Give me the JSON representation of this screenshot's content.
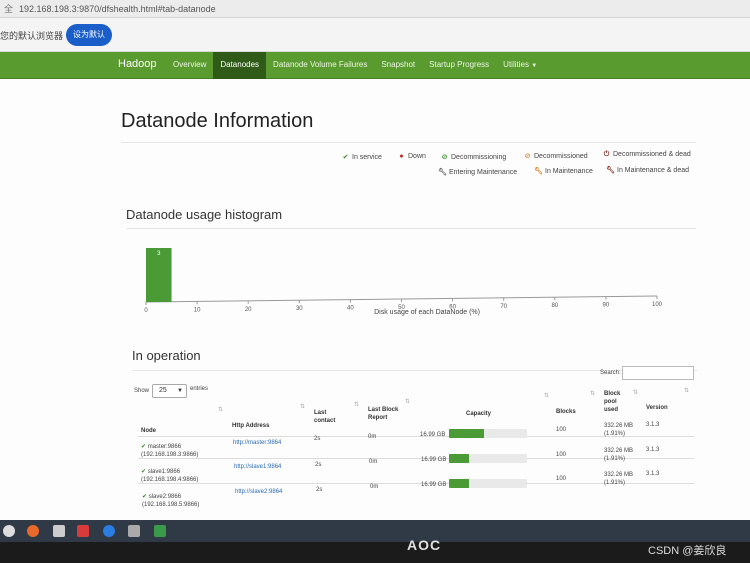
{
  "browser": {
    "url": "192.168.198.3:9870/dfshealth.html#tab-datanode",
    "infobar_message": "您的默认浏览器",
    "set_default_label": "设为默认"
  },
  "nav": {
    "brand": "Hadoop",
    "items": [
      {
        "label": "Overview",
        "active": false
      },
      {
        "label": "Datanodes",
        "active": true
      },
      {
        "label": "Datanode Volume Failures",
        "active": false
      },
      {
        "label": "Snapshot",
        "active": false
      },
      {
        "label": "Startup Progress",
        "active": false
      },
      {
        "label": "Utilities",
        "active": false
      }
    ]
  },
  "title": "Datanode Information",
  "legend": {
    "in_service": "In service",
    "down": "Down",
    "decommissioning": "Decommissioning",
    "decommissioned": "Decommissioned",
    "decommissioned_dead": "Decommissioned & dead",
    "entering_maintenance": "Entering Maintenance",
    "in_maintenance": "In Maintenance",
    "in_maintenance_dead": "In Maintenance & dead"
  },
  "histogram": {
    "heading": "Datanode usage histogram"
  },
  "chart_data": {
    "type": "bar",
    "title": "Datanode usage histogram",
    "xlabel": "Disk usage of each DataNode (%)",
    "ylabel": "",
    "xlim": [
      0,
      100
    ],
    "x_ticks": [
      "0",
      "10",
      "20",
      "30",
      "40",
      "50",
      "60",
      "70",
      "80",
      "90",
      "100"
    ],
    "bins": [
      {
        "x0": 0,
        "x1": 5,
        "value": 3
      }
    ],
    "values": [
      3
    ],
    "grid": false
  },
  "operation": {
    "heading": "In operation",
    "show_label": "Show",
    "entries_value": "25",
    "entries_label": "entries",
    "search_label": "Search:",
    "columns": {
      "node": "Node",
      "http": "Http Address",
      "contact_1": "Last",
      "contact_2": "contact",
      "report_1": "Last Block",
      "report_2": "Report",
      "capacity": "Capacity",
      "blocks": "Blocks",
      "pool_1": "Block",
      "pool_2": "pool",
      "pool_3": "used",
      "version": "Version"
    },
    "rows": [
      {
        "node": "master:9866",
        "ip": "(192.168.198.3:9866)",
        "http": "http://master:9864",
        "contact": "2s",
        "report": "0m",
        "capacity": "16.99 GB",
        "used_pct": 0.45,
        "blocks": "100",
        "pool": "332.26 MB",
        "pool_pct": "(1.91%)",
        "version": "3.1.3"
      },
      {
        "node": "slave1:9866",
        "ip": "(192.168.198.4:9866)",
        "http": "http://slave1:9864",
        "contact": "2s",
        "report": "0m",
        "capacity": "16.99 GB",
        "used_pct": 0.25,
        "blocks": "100",
        "pool": "332.26 MB",
        "pool_pct": "(1.91%)",
        "version": "3.1.3"
      },
      {
        "node": "slave2:9866",
        "ip": "(192.168.198.5:9866)",
        "http": "http://slave2:9864",
        "contact": "2s",
        "report": "0m",
        "capacity": "16.99 GB",
        "used_pct": 0.25,
        "blocks": "100",
        "pool": "332.26 MB",
        "pool_pct": "(1.91%)",
        "version": "3.1.3"
      }
    ]
  },
  "monitor": {
    "brand": "AOC"
  },
  "watermark": "CSDN @姜欣良"
}
